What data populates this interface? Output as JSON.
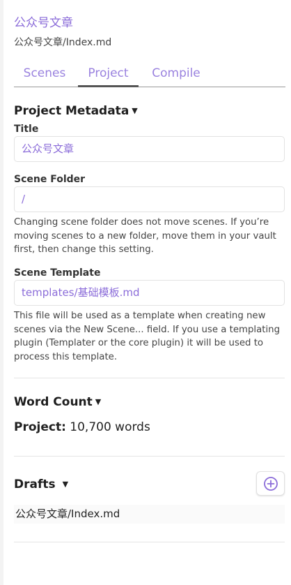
{
  "project": {
    "title": "公众号文章",
    "path": "公众号文章/Index.md"
  },
  "tabs": [
    {
      "label": "Scenes",
      "active": false
    },
    {
      "label": "Project",
      "active": true
    },
    {
      "label": "Compile",
      "active": false
    }
  ],
  "metadata": {
    "heading": "Project Metadata",
    "title_label": "Title",
    "title_value": "公众号文章",
    "scene_folder_label": "Scene Folder",
    "scene_folder_value": "/",
    "scene_folder_help": "Changing scene folder does not move scenes. If you’re moving scenes to a new folder, move them in your vault first, then change this setting.",
    "scene_template_label": "Scene Template",
    "scene_template_value": "templates/基础模板.md",
    "scene_template_help": "This file will be used as a template when creating new scenes via the New Scene... field. If you use a templating plugin (Templater or the core plugin) it will be used to process this template."
  },
  "word_count": {
    "heading": "Word Count",
    "project_label": "Project:",
    "project_value": "10,700 words"
  },
  "drafts": {
    "heading": "Drafts",
    "items": [
      "公众号文章/Index.md"
    ]
  },
  "icons": {
    "caret": "caret-down-icon",
    "add": "plus-circle-icon"
  },
  "colors": {
    "accent": "#8b6cd9",
    "tab_text": "#9a82df",
    "text": "#222222"
  }
}
